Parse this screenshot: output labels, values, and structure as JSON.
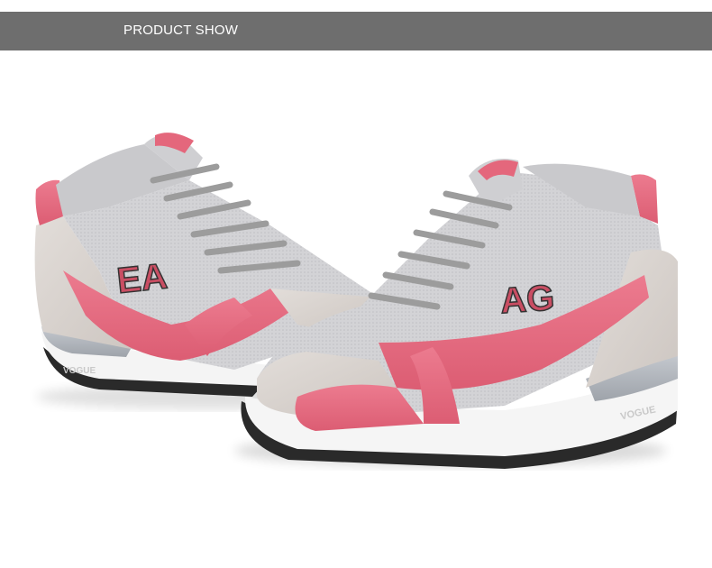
{
  "header": {
    "title": "PRODUCT SHOW",
    "background": "#6e6e6e",
    "text_color": "#ffffff"
  },
  "product": {
    "left_shoe_logo": "EA",
    "right_shoe_logo": "AG",
    "sole_text": "VOGUE",
    "colors": {
      "pink": "#e4677c",
      "mesh_gray": "#cfcfd1",
      "suede_beige": "#d8d2ce",
      "lace_gray": "#9c9c9c",
      "sole_white": "#f4f4f4",
      "sole_black": "#2a2a2a"
    }
  }
}
